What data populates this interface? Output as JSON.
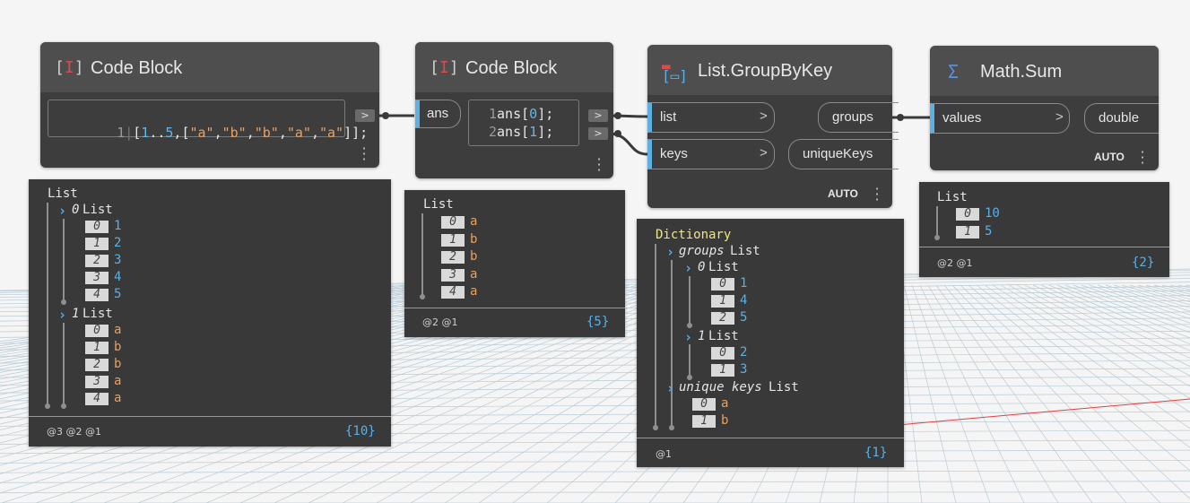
{
  "nodes": {
    "cb1": {
      "title": "Code Block",
      "code": {
        "line_no": "1",
        "open": "[",
        "n1": "1",
        "dots": "..",
        "n5": "5",
        "comma1": ",",
        "lb": "[",
        "s1": "\"a\"",
        "c2": ",",
        "s2": "\"b\"",
        "c3": ",",
        "s3": "\"b\"",
        "c4": ",",
        "s4": "\"a\"",
        "c5": ",",
        "s5": "\"a\"",
        "close": "]];"
      },
      "out_label": ">"
    },
    "cb2": {
      "title": "Code Block",
      "input_label": "ans",
      "code": {
        "l1": "1",
        "l1a": "ans[",
        "l1n": "0",
        "l1b": "];",
        "l2": "2",
        "l2a": "ans[",
        "l2n": "1",
        "l2b": "];"
      },
      "out_label": ">"
    },
    "group": {
      "title": "List.GroupByKey",
      "inputs": [
        "list",
        "keys"
      ],
      "outputs": [
        "groups",
        "uniqueKeys"
      ],
      "arrow": ">",
      "lacing": "AUTO"
    },
    "sum": {
      "title": "Math.Sum",
      "input": "values",
      "output": "double",
      "arrow": ">",
      "lacing": "AUTO"
    }
  },
  "previews": {
    "cb1": {
      "root": "List",
      "sub0": {
        "index": "0",
        "label": "List",
        "items": [
          [
            "0",
            "1"
          ],
          [
            "1",
            "2"
          ],
          [
            "2",
            "3"
          ],
          [
            "3",
            "4"
          ],
          [
            "4",
            "5"
          ]
        ]
      },
      "sub1": {
        "index": "1",
        "label": "List",
        "items": [
          [
            "0",
            "a"
          ],
          [
            "1",
            "b"
          ],
          [
            "2",
            "b"
          ],
          [
            "3",
            "a"
          ],
          [
            "4",
            "a"
          ]
        ]
      },
      "levels": "@3 @2 @1",
      "count": "{10}"
    },
    "cb2": {
      "root": "List",
      "items": [
        [
          "0",
          "a"
        ],
        [
          "1",
          "b"
        ],
        [
          "2",
          "b"
        ],
        [
          "3",
          "a"
        ],
        [
          "4",
          "a"
        ]
      ],
      "levels": "@2 @1",
      "count": "{5}"
    },
    "group": {
      "root": "Dictionary",
      "groups_key": "groups",
      "groups_label": "List",
      "g0": {
        "index": "0",
        "label": "List",
        "items": [
          [
            "0",
            "1"
          ],
          [
            "1",
            "4"
          ],
          [
            "2",
            "5"
          ]
        ]
      },
      "g1": {
        "index": "1",
        "label": "List",
        "items": [
          [
            "0",
            "2"
          ],
          [
            "1",
            "3"
          ]
        ]
      },
      "keys_key": "unique keys",
      "keys_label": "List",
      "keys": [
        [
          "0",
          "a"
        ],
        [
          "1",
          "b"
        ]
      ],
      "levels": "@1",
      "count": "{1}"
    },
    "sum": {
      "root": "List",
      "items": [
        [
          "0",
          "10"
        ],
        [
          "1",
          "5"
        ]
      ],
      "levels": "@2 @1",
      "count": "{2}"
    }
  },
  "colors": {
    "port_accent": "#5fb0e0",
    "number": "#5bb0e6",
    "string": "#e8a060",
    "dictionary": "#f0e48a",
    "grid_axis": "#e04040"
  }
}
